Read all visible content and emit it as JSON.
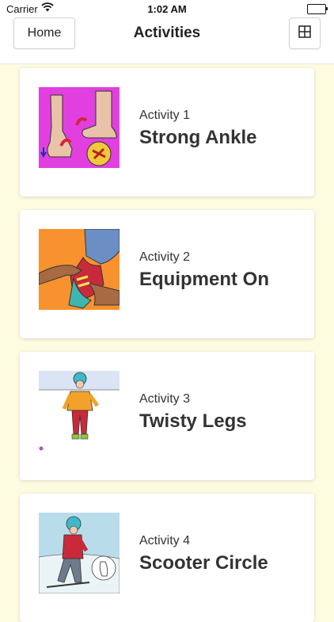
{
  "status_bar": {
    "carrier": "Carrier",
    "time": "1:02 AM"
  },
  "nav": {
    "home_label": "Home",
    "title": "Activities",
    "grid_icon": "grid-icon"
  },
  "activities": [
    {
      "number": "Activity 1",
      "name": "Strong Ankle",
      "image": "ankle-exercise-illustration"
    },
    {
      "number": "Activity 2",
      "name": "Equipment On",
      "image": "putting-on-ski-boot-illustration"
    },
    {
      "number": "Activity 3",
      "name": "Twisty Legs",
      "image": "child-skier-illustration"
    },
    {
      "number": "Activity 4",
      "name": "Scooter Circle",
      "image": "child-on-one-ski-illustration"
    }
  ],
  "colors": {
    "background": "#fdfbe0",
    "card": "#ffffff",
    "thumb_1_bg": "#e23fe0",
    "thumb_2_bg": "#f7922e",
    "thumb_3_sky": "#dbe4f5",
    "thumb_4_sky": "#b9dcea"
  }
}
